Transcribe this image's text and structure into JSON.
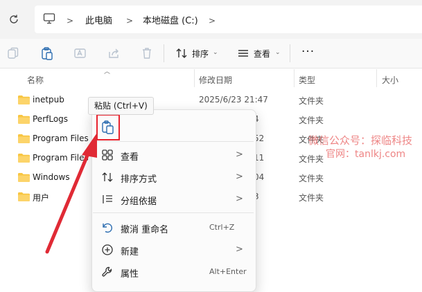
{
  "address_bar": {
    "breadcrumbs": [
      "此电脑",
      "本地磁盘 (C:)"
    ]
  },
  "command_bar": {
    "sort_label": "排序",
    "view_label": "查看",
    "more_label": "···"
  },
  "columns": {
    "name": "名称",
    "date": "修改日期",
    "type": "类型",
    "size": "大小"
  },
  "files": [
    {
      "name": "inetpub",
      "date": "2025/6/23 21:47",
      "type": "文件夹"
    },
    {
      "name": "PerfLogs",
      "date": "4",
      "type": "文件夹"
    },
    {
      "name": "Program Files",
      "date": "52",
      "type": "文件夹"
    },
    {
      "name": "Program Files",
      "date": "11",
      "type": "文件夹"
    },
    {
      "name": "Windows",
      "date": "04",
      "type": "文件夹"
    },
    {
      "name": "用户",
      "date": "3",
      "type": "文件夹"
    }
  ],
  "tooltip": "粘贴 (Ctrl+V)",
  "context_menu": {
    "items": [
      {
        "label": "查看",
        "shortcut": "",
        "submenu": true,
        "icon": "grid-view-icon"
      },
      {
        "label": "排序方式",
        "shortcut": "",
        "submenu": true,
        "icon": "sort-icon"
      },
      {
        "label": "分组依据",
        "shortcut": "",
        "submenu": true,
        "icon": "group-by-icon"
      },
      {
        "label": "撤消 重命名",
        "shortcut": "Ctrl+Z",
        "submenu": false,
        "icon": "undo-icon"
      },
      {
        "label": "新建",
        "shortcut": "",
        "submenu": true,
        "icon": "new-icon"
      },
      {
        "label": "属性",
        "shortcut": "Alt+Enter",
        "submenu": false,
        "icon": "wrench-icon"
      }
    ]
  },
  "watermark": {
    "line1": "微信公众号：探临科技",
    "line2": "官网：tanlkj.com"
  },
  "colors": {
    "folder": "#f8c642",
    "highlight": "#e8232e",
    "arrow": "#e02a35"
  }
}
